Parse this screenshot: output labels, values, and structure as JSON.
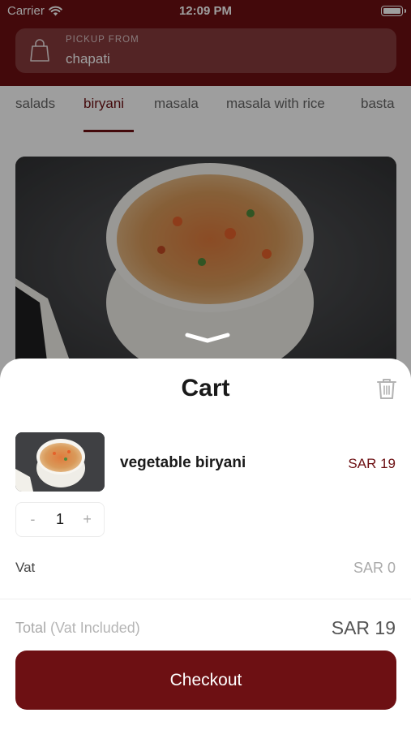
{
  "status_bar": {
    "carrier": "Carrier",
    "time": "12:09 PM"
  },
  "header": {
    "pickup_label": "PICKUP FROM",
    "pickup_value": "chapati",
    "background_color": "#6d1013"
  },
  "categories": {
    "tabs": [
      "salads",
      "biryani",
      "masala",
      "masala with rice",
      "basta"
    ],
    "active": "biryani"
  },
  "cart": {
    "title": "Cart",
    "item": {
      "name": "vegetable biryani",
      "price": "SAR 19",
      "quantity": "1",
      "minus": "-",
      "plus": "+"
    },
    "vat_label": "Vat",
    "vat_value": "SAR 0",
    "total_label": "Total",
    "total_note": "(Vat Included)",
    "total_value": "SAR 19",
    "checkout_label": "Checkout"
  },
  "icons": {
    "wifi": "wifi-icon",
    "battery": "battery-icon",
    "pickup": "shopping-bag-icon",
    "trash": "trash-icon",
    "grabber": "chevron-down-icon"
  },
  "colors": {
    "brand": "#6d1013",
    "price": "#6d1013"
  }
}
